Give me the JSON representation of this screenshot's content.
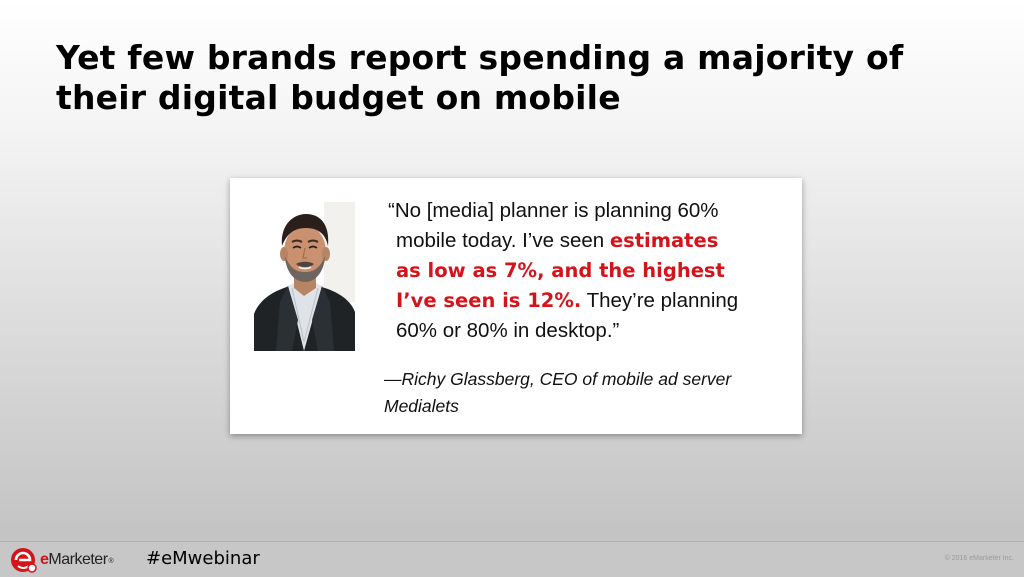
{
  "slide": {
    "title_lines": [
      "Yet few brands report spending a majority of",
      "their digital budget on mobile"
    ]
  },
  "quote": {
    "line1": "“No [media] planner is planning 60%",
    "line2_plain": "mobile today. I’ve seen ",
    "line2_highlight": "estimates",
    "line3_highlight": "as low as 7%, and the highest",
    "line4_highlight": "I’ve seen is 12%.",
    "line4_plain": " They’re planning",
    "line5": "60% or 80% in desktop.”",
    "highlight_color": "#d4141a"
  },
  "attribution": {
    "line1": "—Richy Glassberg, CEO of mobile ad server",
    "line2": "Medialets"
  },
  "footer": {
    "logo_e": "e",
    "logo_rest": "Marketer",
    "logo_reg": "®",
    "hashtag": "#eMwebinar",
    "copyright": "© 2016 eMarketer Inc."
  },
  "icons": {
    "logo": "emarketer-logo-icon",
    "portrait": "speaker-portrait"
  }
}
